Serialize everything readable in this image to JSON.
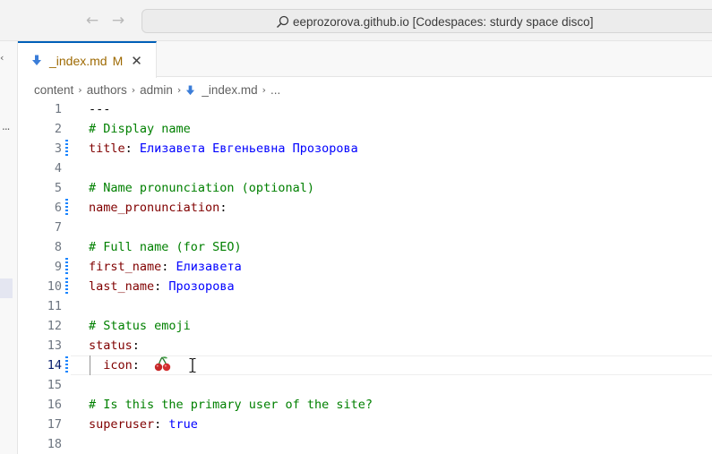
{
  "titlebar": {
    "back_glyph": "←",
    "forward_glyph": "→",
    "command_center_text": "eeprozorova.github.io [Codespaces: sturdy space disco]"
  },
  "leftstrip": {
    "chevron": "‹",
    "dots": "..."
  },
  "tab": {
    "label": "_index.md",
    "modified": "M",
    "close": "✕"
  },
  "breadcrumb": {
    "items": [
      "content",
      "authors",
      "admin",
      "_index.md",
      "..."
    ],
    "separator": "›"
  },
  "editor": {
    "lines": [
      {
        "num": "1",
        "tokens": [
          {
            "t": "---",
            "c": "punct"
          }
        ]
      },
      {
        "num": "2",
        "tokens": [
          {
            "t": "# Display name",
            "c": "comment"
          }
        ]
      },
      {
        "num": "3",
        "modified": true,
        "tokens": [
          {
            "t": "title",
            "c": "key"
          },
          {
            "t": ": ",
            "c": "punct"
          },
          {
            "t": "Елизавета Евгеньевна Прозорова",
            "c": "str"
          }
        ]
      },
      {
        "num": "4",
        "tokens": []
      },
      {
        "num": "5",
        "tokens": [
          {
            "t": "# Name pronunciation (optional)",
            "c": "comment"
          }
        ]
      },
      {
        "num": "6",
        "modified": true,
        "tokens": [
          {
            "t": "name_pronunciation",
            "c": "key"
          },
          {
            "t": ":",
            "c": "punct"
          }
        ]
      },
      {
        "num": "7",
        "tokens": []
      },
      {
        "num": "8",
        "tokens": [
          {
            "t": "# Full name (for SEO)",
            "c": "comment"
          }
        ]
      },
      {
        "num": "9",
        "modified": true,
        "tokens": [
          {
            "t": "first_name",
            "c": "key"
          },
          {
            "t": ": ",
            "c": "punct"
          },
          {
            "t": "Елизавета",
            "c": "str"
          }
        ]
      },
      {
        "num": "10",
        "modified": true,
        "tokens": [
          {
            "t": "last_name",
            "c": "key"
          },
          {
            "t": ": ",
            "c": "punct"
          },
          {
            "t": "Прозорова",
            "c": "str"
          }
        ]
      },
      {
        "num": "11",
        "tokens": []
      },
      {
        "num": "12",
        "tokens": [
          {
            "t": "# Status emoji",
            "c": "comment"
          }
        ]
      },
      {
        "num": "13",
        "tokens": [
          {
            "t": "status",
            "c": "key"
          },
          {
            "t": ":",
            "c": "punct"
          }
        ]
      },
      {
        "num": "14",
        "modified": true,
        "current": true,
        "tokens": [
          {
            "t": "  icon",
            "c": "key"
          },
          {
            "t": ": ",
            "c": "punct"
          }
        ],
        "emoji": "cherries-emoji"
      },
      {
        "num": "15",
        "tokens": []
      },
      {
        "num": "16",
        "tokens": [
          {
            "t": "# Is this the primary user of the site?",
            "c": "comment"
          }
        ]
      },
      {
        "num": "17",
        "tokens": [
          {
            "t": "superuser",
            "c": "key"
          },
          {
            "t": ": ",
            "c": "punct"
          },
          {
            "t": "true",
            "c": "bool"
          }
        ]
      },
      {
        "num": "18",
        "tokens": []
      }
    ]
  },
  "colors": {
    "accent": "#005fb8",
    "modified_tab": "#9e6a03",
    "comment": "#008000",
    "key": "#800000",
    "string": "#0000ff",
    "gutter_modified": "#1a85ff"
  }
}
